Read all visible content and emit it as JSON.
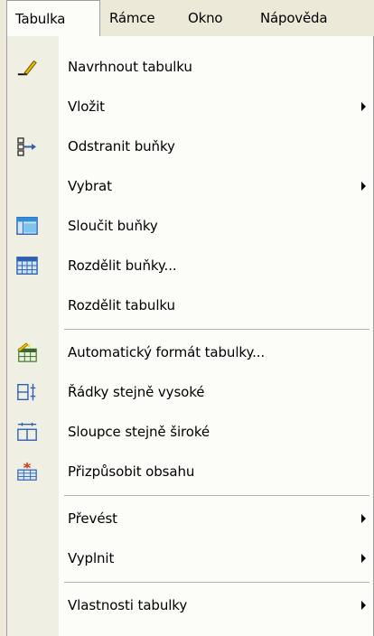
{
  "menubar": {
    "items": [
      {
        "label": "Tabulka"
      },
      {
        "label": "Rámce"
      },
      {
        "label": "Okno"
      },
      {
        "label": "Nápověda"
      }
    ]
  },
  "menu": {
    "items": [
      {
        "label": "Navrhnout tabulku",
        "icon": "pencil-icon"
      },
      {
        "label": "Vložit",
        "submenu": true
      },
      {
        "label": "Odstranit buňky",
        "icon": "delete-cells-icon"
      },
      {
        "label": "Vybrat",
        "submenu": true
      },
      {
        "label": "Sloučit buňky",
        "icon": "merge-cells-icon"
      },
      {
        "label": "Rozdělit buňky...",
        "icon": "split-cells-icon"
      },
      {
        "label": "Rozdělit tabulku"
      },
      {
        "label": "Automatický formát tabulky...",
        "icon": "autoformat-icon"
      },
      {
        "label": "Řádky stejně vysoké",
        "icon": "distribute-rows-icon"
      },
      {
        "label": "Sloupce stejně široké",
        "icon": "distribute-columns-icon"
      },
      {
        "label": "Přizpůsobit obsahu",
        "icon": "autofit-icon"
      },
      {
        "label": "Převést",
        "submenu": true
      },
      {
        "label": "Vyplnit",
        "submenu": true
      },
      {
        "label": "Vlastnosti tabulky",
        "submenu": true
      }
    ]
  },
  "colors": {
    "menu_bg": "#fcfcf9",
    "gutter_bg": "#f0efe4",
    "bar_bg": "#ece9d8",
    "icon_blue": "#2f5fb3"
  }
}
